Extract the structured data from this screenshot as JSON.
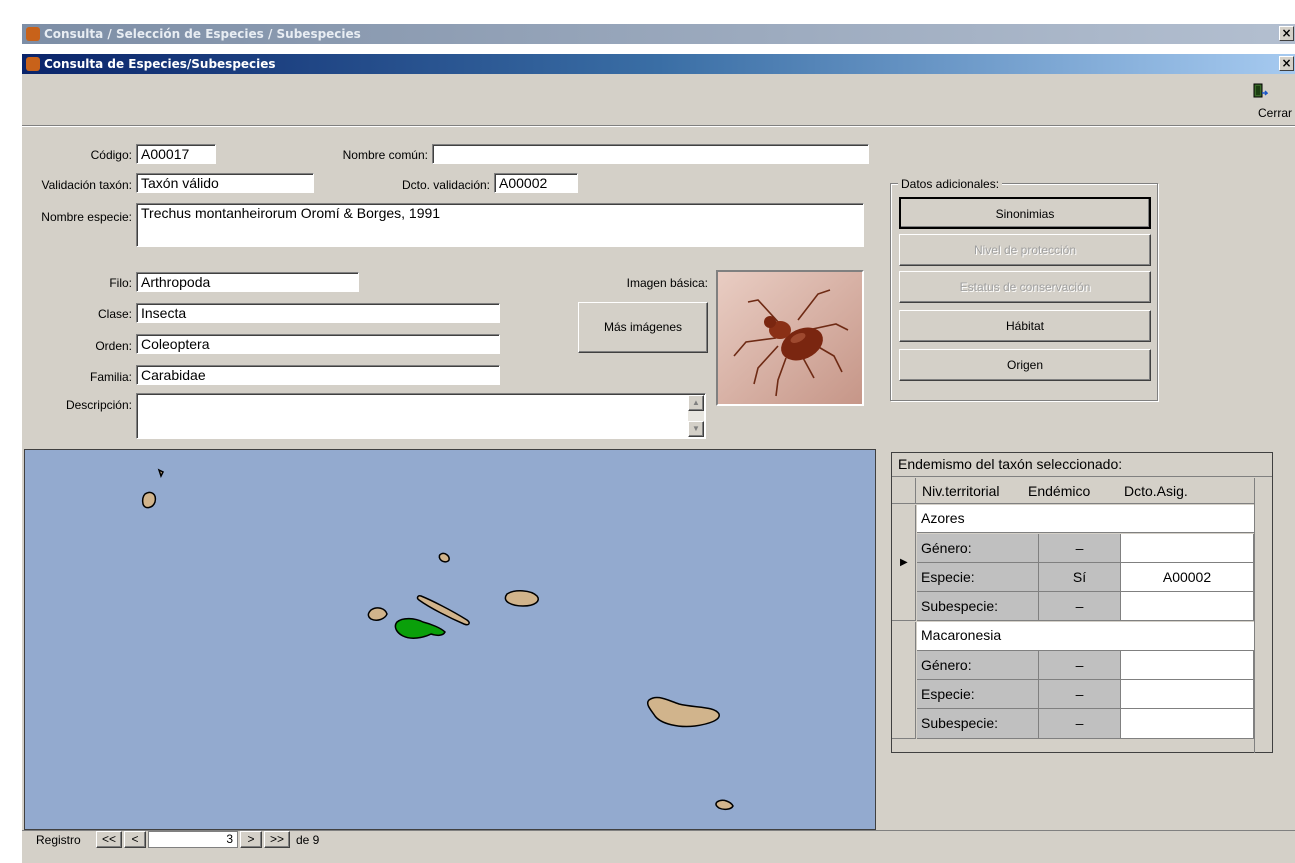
{
  "window": {
    "title": "Consulta / Selección de Especies / Subespecies",
    "close": "×"
  },
  "child": {
    "title": "Consulta de Especies/Subespecies",
    "close": "×"
  },
  "toolbar": {
    "close_label": "Cerrar"
  },
  "form": {
    "codigo_label": "Código:",
    "codigo": "A00017",
    "nombre_comun_label": "Nombre común:",
    "nombre_comun": "",
    "validacion_label": "Validación taxón:",
    "validacion": "Taxón válido",
    "dcto_label": "Dcto. validación:",
    "dcto": "A00002",
    "nombre_especie_label": "Nombre especie:",
    "nombre_especie": "Trechus montanheirorum Oromí & Borges, 1991",
    "filo_label": "Filo:",
    "filo": "Arthropoda",
    "clase_label": "Clase:",
    "clase": "Insecta",
    "orden_label": "Orden:",
    "orden": "Coleoptera",
    "familia_label": "Familia:",
    "familia": "Carabidae",
    "descripcion_label": "Descripción:",
    "descripcion": "",
    "imagen_label": "Imagen básica:",
    "mas_imagenes": "Más imágenes"
  },
  "datos": {
    "legend": "Datos adicionales:",
    "sinonimias": "Sinonimias",
    "nivel": "Nivel de protección",
    "estatus": "Estatus de conservación",
    "habitat": "Hábitat",
    "origen": "Origen"
  },
  "endemismo": {
    "title": "Endemismo del taxón seleccionado:",
    "headers": [
      "Niv.territorial",
      "Endémico",
      "Dcto.Asig."
    ],
    "groups": [
      {
        "name": "Azores",
        "rows": [
          {
            "nivel": "Género:",
            "endemico": "–",
            "dcto": ""
          },
          {
            "nivel": "Especie:",
            "endemico": "Sí",
            "dcto": "A00002"
          },
          {
            "nivel": "Subespecie:",
            "endemico": "–",
            "dcto": ""
          }
        ]
      },
      {
        "name": "Macaronesia",
        "rows": [
          {
            "nivel": "Género:",
            "endemico": "–",
            "dcto": ""
          },
          {
            "nivel": "Especie:",
            "endemico": "–",
            "dcto": ""
          },
          {
            "nivel": "Subespecie:",
            "endemico": "–",
            "dcto": ""
          }
        ]
      }
    ]
  },
  "nav": {
    "label": "Registro",
    "first": "<<",
    "prev": "<",
    "value": "3",
    "next": ">",
    "last": ">>",
    "total": "de 9"
  },
  "colors": {
    "map_sea": "#93aacf",
    "island": "#d1b48c",
    "island_selected": "#0aa00a"
  }
}
